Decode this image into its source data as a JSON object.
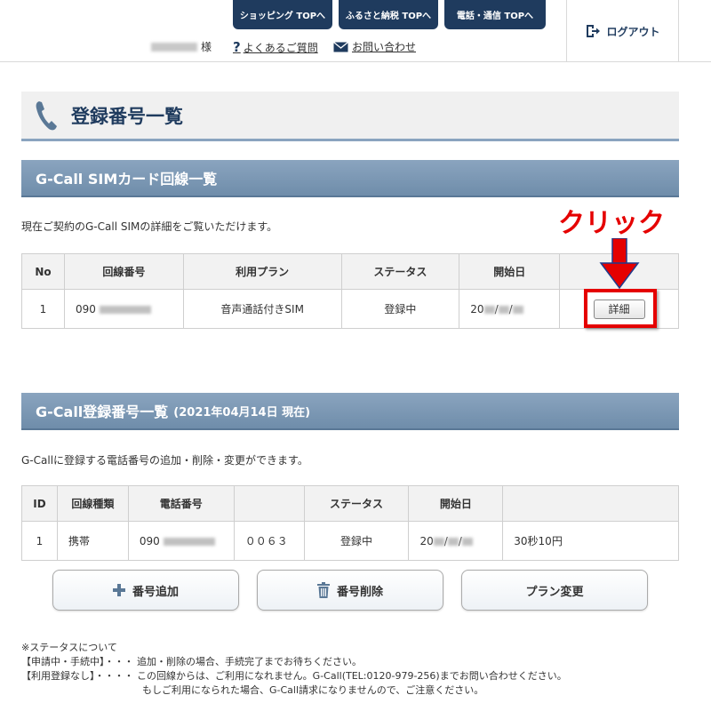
{
  "header": {
    "tabs": [
      "ショッピング TOPへ",
      "ふるさと納税 TOPへ",
      "電話・通信 TOPへ"
    ],
    "user_suffix": "様",
    "faq_label": "よくあるご質問",
    "contact_label": "お問い合わせ",
    "logout_label": "ログアウト"
  },
  "page": {
    "title": "登録番号一覧"
  },
  "sim_section": {
    "title": "G-Call SIMカード回線一覧",
    "description": "現在ご契約のG-Call SIMの詳細をご覧いただけます。",
    "columns": [
      "No",
      "回線番号",
      "利用プラン",
      "ステータス",
      "開始日",
      ""
    ],
    "row": {
      "no": "1",
      "number_prefix": "090",
      "plan": "音声通話付きSIM",
      "status": "登録中",
      "date_prefix": "20",
      "date_sep": "/",
      "detail_label": "詳細"
    }
  },
  "annotation": {
    "text": "クリック"
  },
  "gcall_section": {
    "title": "G-Call登録番号一覧",
    "date_note": "(2021年04月14日 現在)",
    "description": "G-Callに登録する電話番号の追加・削除・変更ができます。",
    "columns": [
      "ID",
      "回線種類",
      "電話番号",
      "",
      "ステータス",
      "開始日",
      ""
    ],
    "row": {
      "id": "1",
      "type": "携帯",
      "number_prefix": "090",
      "code": "００６３",
      "status": "登録中",
      "date_prefix": "20",
      "date_sep": "/",
      "plan": "30秒10円"
    }
  },
  "buttons": {
    "add": "番号追加",
    "delete": "番号削除",
    "change": "プラン変更"
  },
  "notes": {
    "heading": "※ステータスについて",
    "line1": "【申請中・手続中】・・・ 追加・削除の場合、手続完了までお待ちください。",
    "line2": "【利用登録なし】・・・・ この回線からは、ご利用になれません。G-Call(TEL:0120-979-256)までお問い合わせください。",
    "line3": "もしご利用になられた場合、G-Call請求になりませんので、ご注意ください。"
  },
  "colors": {
    "navy": "#1f3b5e",
    "section": "#7b97b3",
    "accent_red": "#e50000"
  }
}
